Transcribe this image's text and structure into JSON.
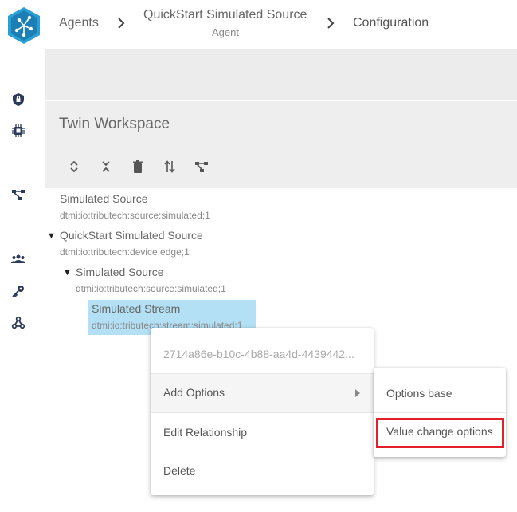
{
  "breadcrumb": {
    "items": [
      {
        "label": "Agents",
        "sub": ""
      },
      {
        "label": "QuickStart Simulated Source",
        "sub": "Agent"
      },
      {
        "label": "Configuration",
        "sub": ""
      }
    ]
  },
  "workspace": {
    "title": "Twin Workspace",
    "toolbar": [
      "expand-all-icon",
      "collapse-all-icon",
      "delete-icon",
      "sort-icon",
      "relationship-icon"
    ]
  },
  "sidebar": {
    "icons": [
      "shield-icon",
      "chip-icon",
      "graph-icon",
      "group-icon",
      "key-icon",
      "webhook-icon"
    ]
  },
  "tree": {
    "nodes": [
      {
        "title": "Simulated Source",
        "sub": "dtmi:io:tributech:source:simulated;1",
        "expanded": false
      },
      {
        "title": "QuickStart Simulated Source",
        "sub": "dtmi:io:tributech:device:edge;1",
        "expanded": true
      },
      {
        "title": "Simulated Source",
        "sub": "dtmi:io:tributech:source:simulated;1",
        "expanded": true
      },
      {
        "title": "Simulated Stream",
        "sub": "dtmi:io:tributech:stream:simulated;1",
        "selected": true
      }
    ]
  },
  "context_menu": {
    "id_text": "2714a86e-b10c-4b88-aa4d-4439442...",
    "items": [
      "Add Options",
      "Edit Relationship",
      "Delete"
    ]
  },
  "submenu": {
    "items": [
      "Options base",
      "Value change options"
    ]
  },
  "colors": {
    "accent": "#2a9fd6",
    "selection": "#b3e0f5",
    "highlight": "#e3202a"
  }
}
